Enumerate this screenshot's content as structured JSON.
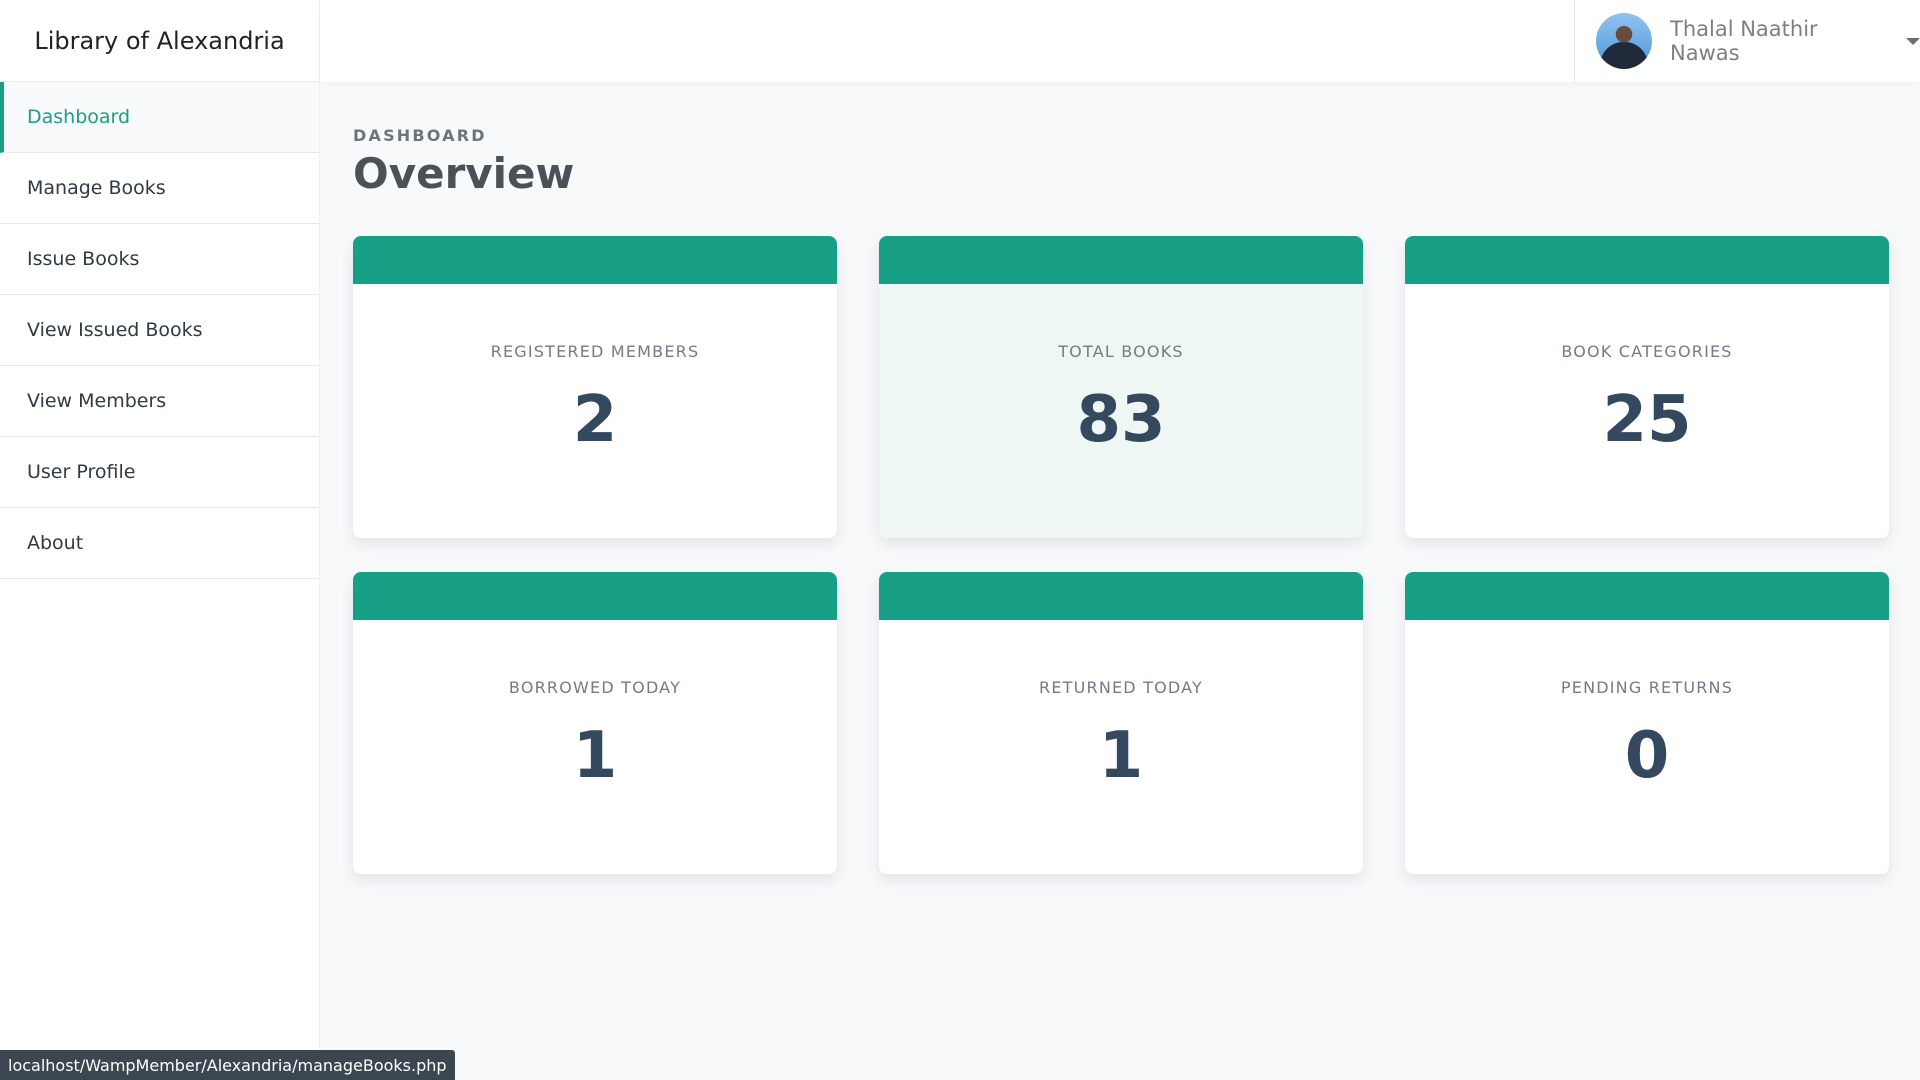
{
  "app": {
    "title": "Library of Alexandria"
  },
  "sidebar": {
    "items": [
      {
        "label": "Dashboard",
        "active": true
      },
      {
        "label": "Manage Books",
        "active": false
      },
      {
        "label": "Issue Books",
        "active": false
      },
      {
        "label": "View Issued Books",
        "active": false
      },
      {
        "label": "View Members",
        "active": false
      },
      {
        "label": "User Profile",
        "active": false
      },
      {
        "label": "About",
        "active": false
      }
    ]
  },
  "user": {
    "name": "Thalal Naathir Nawas",
    "avatar_icon": "avatar"
  },
  "header": {
    "breadcrumb": "DASHBOARD",
    "title": "Overview"
  },
  "stats": [
    {
      "label": "REGISTERED MEMBERS",
      "value": "2"
    },
    {
      "label": "TOTAL BOOKS",
      "value": "83"
    },
    {
      "label": "BOOK CATEGORIES",
      "value": "25"
    },
    {
      "label": "BORROWED TODAY",
      "value": "1"
    },
    {
      "label": "RETURNED TODAY",
      "value": "1"
    },
    {
      "label": "PENDING RETURNS",
      "value": "0"
    }
  ],
  "status_bar": {
    "url": "localhost/WampMember/Alexandria/manageBooks.php"
  },
  "colors": {
    "accent": "#17a085",
    "value_text": "#34495e",
    "highlight_card": "#eef7f4"
  }
}
